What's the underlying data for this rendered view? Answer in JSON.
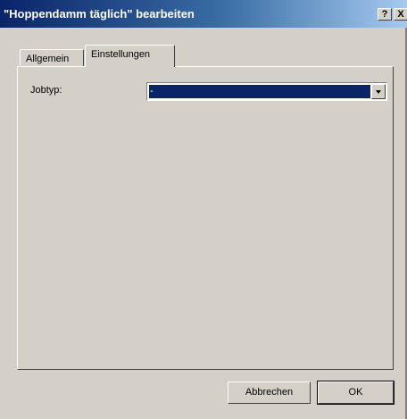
{
  "window": {
    "title": "\"Hoppendamm täglich\" bearbeiten",
    "help_label": "?",
    "close_label": "X"
  },
  "tabs": [
    {
      "label": "Allgemein",
      "active": false
    },
    {
      "label": "Einstellungen",
      "active": true
    }
  ],
  "settings": {
    "jobtyp_label": "Jobtyp:",
    "jobtyp_value": "-"
  },
  "buttons": {
    "cancel_label": "Abbrechen",
    "ok_label": "OK"
  },
  "colors": {
    "title_start": "#0a246a",
    "title_end": "#a6caf0",
    "selection": "#0a246a",
    "face": "#d4d0c8"
  }
}
